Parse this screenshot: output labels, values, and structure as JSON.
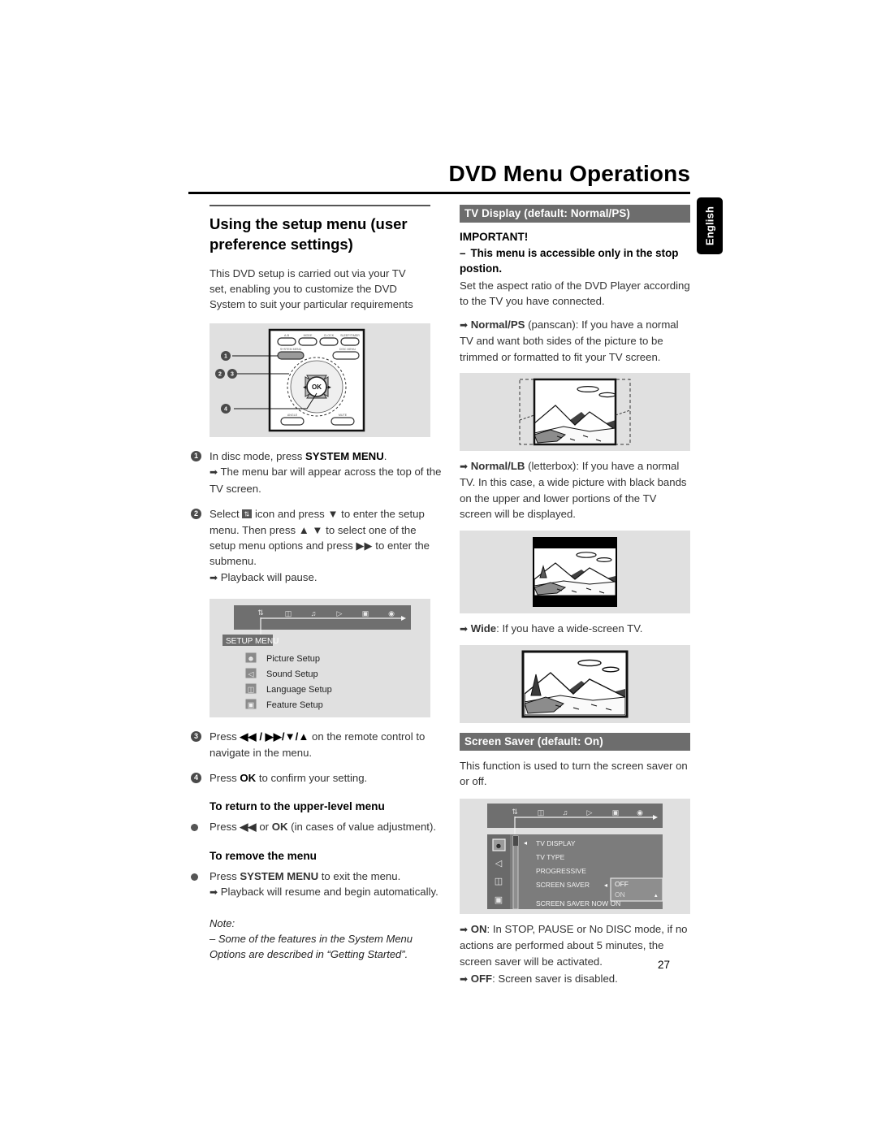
{
  "header": {
    "title": "DVD Menu Operations",
    "language_tab": "English"
  },
  "page_number": "27",
  "left_column": {
    "section_title": "Using the setup menu (user preference settings)",
    "intro": "This DVD setup is carried out via your TV set, enabling you to customize the DVD System to suit your particular requirements",
    "remote_figure": {
      "name": "remote-control-diagram",
      "callouts": [
        "1",
        "2",
        "3",
        "4"
      ],
      "button_labels": [
        "A-B",
        "MODE",
        "CLOCK",
        "SLEEP/TIMER",
        "SYSTEM MENU",
        "DISC MENU",
        "OK",
        "ANGLE",
        "MUTE"
      ],
      "center_button": "OK"
    },
    "steps": [
      {
        "num": "1",
        "text_pre": "In disc mode, press ",
        "bold": "SYSTEM MENU",
        "text_post": ".",
        "result": "The menu bar will appear across the top of the TV screen."
      },
      {
        "num": "2",
        "line1_pre": "Select ",
        "line1_icon": "setup-icon",
        "line1_mid": " icon and press ",
        "line1_key1": "▼",
        "line1_post": " to enter the setup menu. Then press ",
        "line1_key2": "▲ ▼",
        "line1_post2": " to select one of the setup menu options and press ",
        "line1_key3": "▶▶",
        "line1_post3": " to enter the submenu.",
        "result": "Playback will pause."
      },
      {
        "num": "3",
        "text_pre": "Press ",
        "keys": "◀◀ / ▶▶/▼/▲",
        "text_post": " on the remote control to navigate in the menu."
      },
      {
        "num": "4",
        "text_pre": "Press ",
        "bold": "OK",
        "text_post": " to confirm your setting."
      }
    ],
    "setup_menu_figure": {
      "name": "setup-menu-osd",
      "menubar_icons": [
        "setup-icon",
        "subtitle-icon",
        "audio-icon",
        "play-icon",
        "screen-icon",
        "disc-icon"
      ],
      "tab_label": "SETUP MENU",
      "items": [
        {
          "icon": "picture-setup-icon",
          "label": "Picture Setup"
        },
        {
          "icon": "sound-setup-icon",
          "label": "Sound Setup"
        },
        {
          "icon": "language-setup-icon",
          "label": "Language Setup"
        },
        {
          "icon": "feature-setup-icon",
          "label": "Feature Setup"
        }
      ]
    },
    "subsections": [
      {
        "heading": "To return to the upper-level menu",
        "bullet_pre": "Press ",
        "bullet_key": "◀◀",
        "bullet_mid": " or ",
        "bullet_bold": "OK",
        "bullet_post": " (in cases of value adjustment)."
      },
      {
        "heading": "To remove the menu",
        "bullet_pre": "Press ",
        "bullet_bold": "SYSTEM MENU",
        "bullet_post": " to exit the menu.",
        "result": "Playback will resume and begin automatically."
      }
    ],
    "note": {
      "label": "Note:",
      "text": "–  Some of the features in the System Menu Options are described in “Getting Started”."
    }
  },
  "right_column": {
    "tv_display": {
      "heading": "TV Display (default: Normal/PS)",
      "important_label": "IMPORTANT!",
      "important_dash": "–",
      "important_text": "This menu is accessible only in the stop postion.",
      "description": "Set the aspect ratio of the DVD Player according to the TV you have connected.",
      "options": [
        {
          "name": "Normal/PS",
          "paren": " (panscan)",
          "text": ": If you have a normal TV and want both sides of the picture to be trimmed or formatted to fit your TV screen.",
          "figure": "panscan-illustration"
        },
        {
          "name": "Normal/LB",
          "paren": " (letterbox)",
          "text": ": If you have a normal TV. In this case, a wide picture with black bands on the upper and lower portions of the TV screen will be displayed.",
          "figure": "letterbox-illustration"
        },
        {
          "name": "Wide",
          "paren": "",
          "text": ": If you have a wide-screen TV.",
          "figure": "widescreen-illustration"
        }
      ]
    },
    "screen_saver": {
      "heading": "Screen Saver (default: On)",
      "description": "This function is used to turn the screen saver on or off.",
      "osd_figure": {
        "name": "screen-saver-osd",
        "menubar_icons": [
          "setup-icon",
          "subtitle-icon",
          "audio-icon",
          "play-icon",
          "screen-icon",
          "disc-icon"
        ],
        "sidebar_icons": [
          "picture-setup-icon",
          "sound-setup-icon",
          "language-setup-icon",
          "feature-setup-icon"
        ],
        "menu_items": [
          "TV DISPLAY",
          "TV TYPE",
          "PROGRESSIVE",
          "SCREEN SAVER"
        ],
        "submenu_options": [
          "OFF",
          "ON"
        ],
        "status_text": "SCREEN SAVER NOW ON"
      },
      "states": [
        {
          "name": "ON",
          "text": ": In STOP, PAUSE or No DISC mode, if no actions are performed about 5 minutes, the screen saver will be activated."
        },
        {
          "name": "OFF",
          "text": ":  Screen saver is disabled."
        }
      ]
    }
  },
  "colors": {
    "heading_bar": "#6d6d6d",
    "figure_bg": "#e0e0e0",
    "osd_bg": "#7a7a7a",
    "text": "#333333"
  }
}
